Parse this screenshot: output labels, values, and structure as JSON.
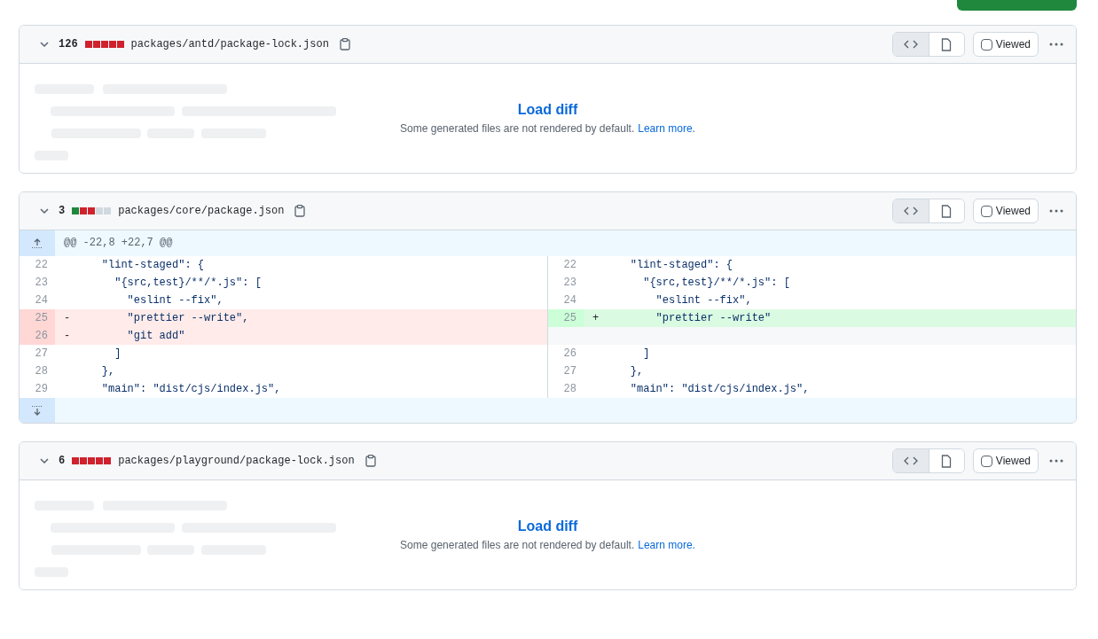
{
  "files": [
    {
      "count": "126",
      "stats": [
        {
          "color": "#cf222e"
        },
        {
          "color": "#cf222e"
        },
        {
          "color": "#cf222e"
        },
        {
          "color": "#cf222e"
        },
        {
          "color": "#cf222e"
        }
      ],
      "path": "packages/antd/package-lock.json",
      "viewed": false,
      "viewed_label": "Viewed",
      "views": [
        {
          "kind": "source",
          "selected": true
        },
        {
          "kind": "rich",
          "selected": false
        }
      ],
      "kind": "load",
      "load_label": "Load diff",
      "note": "Some generated files are not rendered by default.",
      "learn_more": "Learn more."
    },
    {
      "count": "3",
      "stats": [
        {
          "color": "#1f883d"
        },
        {
          "color": "#cf222e"
        },
        {
          "color": "#cf222e"
        },
        {
          "color": "#d1d9e0"
        },
        {
          "color": "#d1d9e0"
        }
      ],
      "path": "packages/core/package.json",
      "viewed": false,
      "viewed_label": "Viewed",
      "views": [
        {
          "kind": "source",
          "selected": true
        },
        {
          "kind": "rich",
          "selected": false
        }
      ],
      "kind": "diff",
      "hunk": "@@ -22,8 +22,7 @@",
      "rows": [
        {
          "left": {
            "num": "22",
            "text": "    \"lint-staged\": {",
            "kind": "context"
          },
          "right": {
            "num": "22",
            "text": "    \"lint-staged\": {",
            "kind": "context"
          }
        },
        {
          "left": {
            "num": "23",
            "text": "      \"{src,test}/**/*.js\": [",
            "kind": "context"
          },
          "right": {
            "num": "23",
            "text": "      \"{src,test}/**/*.js\": [",
            "kind": "context"
          }
        },
        {
          "left": {
            "num": "24",
            "text": "        \"eslint --fix\",",
            "kind": "context"
          },
          "right": {
            "num": "24",
            "text": "        \"eslint --fix\",",
            "kind": "context"
          }
        },
        {
          "left": {
            "num": "25",
            "sign": "-",
            "text": "        \"prettier --write\",",
            "kind": "deleted"
          },
          "right": {
            "num": "25",
            "sign": "+",
            "text": "        \"prettier --write\"",
            "kind": "added"
          }
        },
        {
          "left": {
            "num": "26",
            "sign": "-",
            "text": "        \"git add\"",
            "kind": "deleted"
          },
          "right": {
            "kind": "empty"
          }
        },
        {
          "left": {
            "num": "27",
            "text": "      ]",
            "kind": "context"
          },
          "right": {
            "num": "26",
            "text": "      ]",
            "kind": "context"
          }
        },
        {
          "left": {
            "num": "28",
            "text": "    },",
            "kind": "context"
          },
          "right": {
            "num": "27",
            "text": "    },",
            "kind": "context"
          }
        },
        {
          "left": {
            "num": "29",
            "text": "    \"main\": \"dist/cjs/index.js\",",
            "kind": "context"
          },
          "right": {
            "num": "28",
            "text": "    \"main\": \"dist/cjs/index.js\",",
            "kind": "context"
          }
        }
      ]
    },
    {
      "count": "6",
      "stats": [
        {
          "color": "#cf222e"
        },
        {
          "color": "#cf222e"
        },
        {
          "color": "#cf222e"
        },
        {
          "color": "#cf222e"
        },
        {
          "color": "#cf222e"
        }
      ],
      "path": "packages/playground/package-lock.json",
      "viewed": false,
      "viewed_label": "Viewed",
      "views": [
        {
          "kind": "source",
          "selected": true
        },
        {
          "kind": "rich",
          "selected": false
        }
      ],
      "kind": "load",
      "load_label": "Load diff",
      "note": "Some generated files are not rendered by default.",
      "learn_more": "Learn more."
    }
  ]
}
